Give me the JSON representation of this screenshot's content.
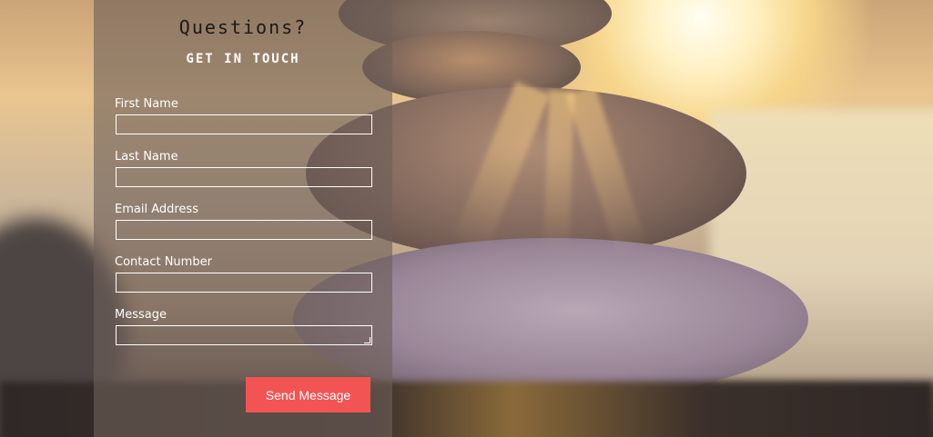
{
  "contact_form": {
    "heading": "Questions?",
    "subheading": "GET IN TOUCH",
    "fields": [
      {
        "label": "First Name",
        "value": ""
      },
      {
        "label": "Last Name",
        "value": ""
      },
      {
        "label": "Email Address",
        "value": ""
      },
      {
        "label": "Contact Number",
        "value": ""
      },
      {
        "label": "Message",
        "value": ""
      }
    ],
    "submit_label": "Send Message"
  },
  "colors": {
    "button": "#f25454",
    "panel_overlay": "#6e6058",
    "text_light": "#ffffff",
    "heading_dark": "#1d1817"
  }
}
